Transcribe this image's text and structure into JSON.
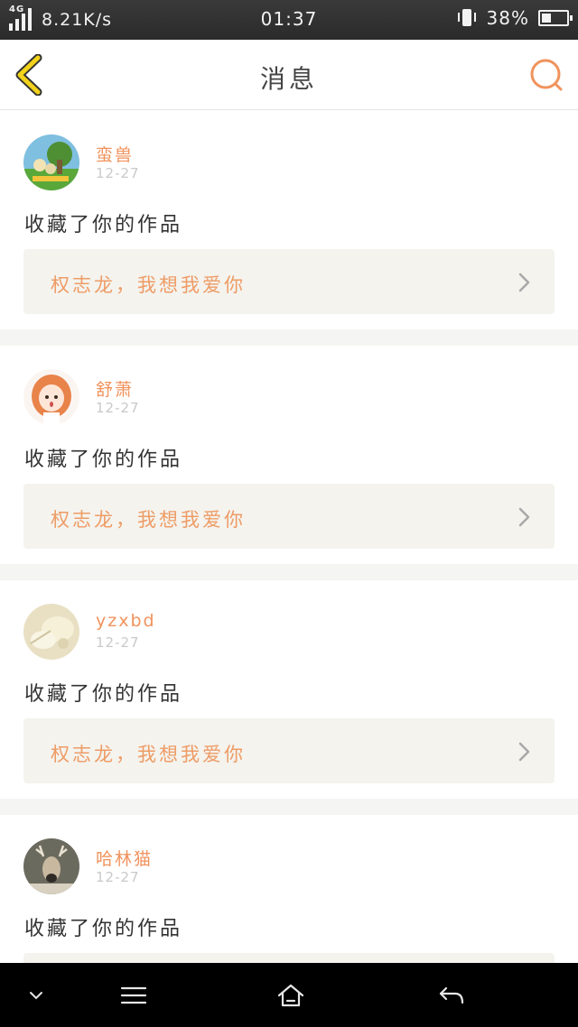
{
  "status_bar": {
    "network": "4G",
    "speed": "8.21K/s",
    "time": "01:37",
    "battery": "38%",
    "battery_level": 0.38
  },
  "header": {
    "title": "消息",
    "back_icon": "chevron-left-icon",
    "search_icon": "search-icon"
  },
  "colors": {
    "accent": "#f0935d",
    "back_icon": "#f2d21a",
    "link_bg": "#f4f3ee"
  },
  "messages": [
    {
      "username": "蛮兽",
      "date": "12-27",
      "action": "收藏了你的作品",
      "work_title": "权志龙，我想我爱你"
    },
    {
      "username": "舒萧",
      "date": "12-27",
      "action": "收藏了你的作品",
      "work_title": "权志龙，我想我爱你"
    },
    {
      "username": "yzxbd",
      "date": "12-27",
      "action": "收藏了你的作品",
      "work_title": "权志龙，我想我爱你"
    },
    {
      "username": "哈林猫",
      "date": "12-27",
      "action": "收藏了你的作品",
      "work_title": ""
    }
  ],
  "nav": {
    "icons": [
      "chevron-down-icon",
      "menu-icon",
      "home-icon",
      "back-arrow-icon"
    ]
  }
}
